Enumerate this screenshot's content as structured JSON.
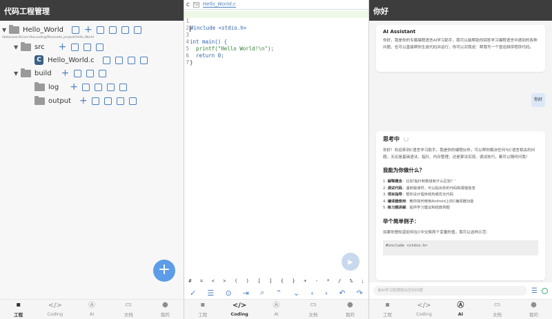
{
  "project_panel": {
    "title": "代码工程管理",
    "root": {
      "name": "Hello_World",
      "path": "/data/user/0/com.fkw.coding/files/code_project/Hello_World"
    },
    "src": {
      "name": "src"
    },
    "file": {
      "name": "Hello_World.c",
      "icon_letter": "C"
    },
    "build": {
      "name": "build"
    },
    "log": {
      "name": "log"
    },
    "output": {
      "name": "output"
    },
    "fab_label": "+"
  },
  "editor": {
    "tab_prefix": "C",
    "tab_icon_text": "Txt",
    "tab_name": "Hello_World.c",
    "lines": [
      {
        "n": "1",
        "code": "#include <stdio.h>"
      },
      {
        "n": "2",
        "code": ""
      },
      {
        "n": "3",
        "code": "int main() {"
      },
      {
        "n": "4",
        "code": "  printf(\"Hello World!\\n\");"
      },
      {
        "n": "5",
        "code": "  return 0;"
      },
      {
        "n": "6",
        "code": "}"
      },
      {
        "n": "7",
        "code": ""
      }
    ],
    "symbols": [
      "#",
      "=",
      "<",
      ">",
      "(",
      ")",
      "[",
      "]",
      "{",
      "}",
      "+",
      "-",
      "*",
      "/",
      "%",
      ";"
    ],
    "tools": [
      "✓",
      "☰",
      "⊙",
      "⇥",
      "⌕",
      "⌃",
      "⌄",
      "‹",
      "›",
      "↶",
      "↷"
    ]
  },
  "ai_panel": {
    "title": "你好",
    "welcome_title": "AI Assistant",
    "welcome_text": "你好，我是你的专属编程语言AI学习助手，我可以能帮助你回答学习编程语言中遇到的各种问题，也可以直接帮你生成代码并运行，你可以对我说：帮我写一个冒泡排序程序代码。",
    "user_message": "你好",
    "thinking_label": "思考中",
    "reply_intro": "你好！欢迎来到C语言学习助手。我是你的编程伙伴，可以帮你解决任何与C语言相关的问题。无论是基础语法、指针、内存管理，还是算法实现、调试技巧，都可以随时问我！",
    "section1": "我能为你做什么？",
    "items": [
      {
        "label": "解释概念",
        "text": "：比如'指针和数组有什么区别？'"
      },
      {
        "label": "调试代码",
        "text": "：遇到错误时，可以贴出你的代码和报错信息"
      },
      {
        "label": "项目指导",
        "text": "：帮你设计程序结构或优化代码"
      },
      {
        "label": "编译器使用",
        "text": "：教你如何使用Android上的C编译器功能"
      },
      {
        "label": "练习题讲解",
        "text": "：提供学习建议和经典例题"
      }
    ],
    "section2": "举个简单例子：",
    "example_text": "如果你想知道如何在C中交换两个变量的值，我可以这样示范：",
    "code_sample": "#include <stdio.h>",
    "input_placeholder": "询AI学习助理提出任何问题"
  },
  "nav": [
    {
      "icon": "▪",
      "label": "工程"
    },
    {
      "icon": "</>",
      "label": "Coding"
    },
    {
      "icon": "Ⓐ",
      "label": "AI"
    },
    {
      "icon": "▭",
      "label": "文档"
    },
    {
      "icon": "●",
      "label": "我的"
    }
  ]
}
